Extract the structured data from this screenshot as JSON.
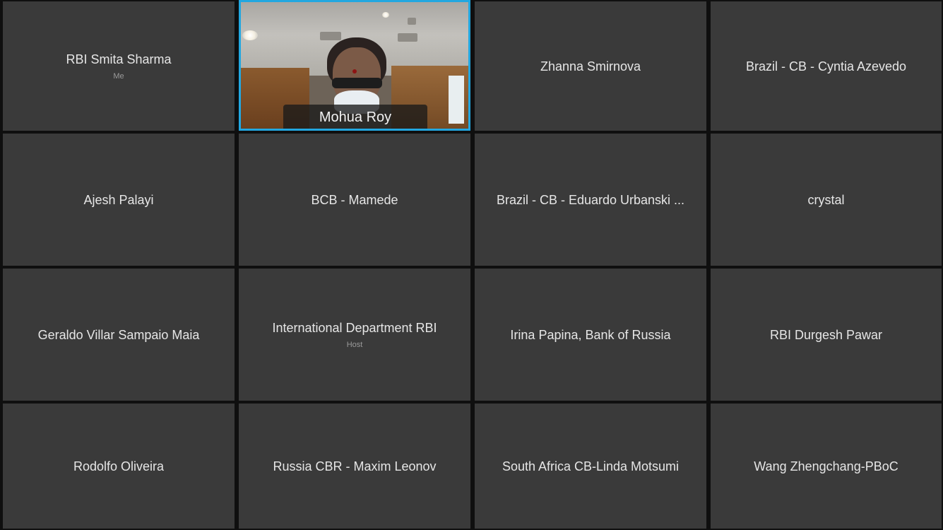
{
  "participants": [
    {
      "name": "RBI Smita Sharma",
      "tag": "Me"
    },
    {
      "name": "Mohua Roy",
      "tag": "",
      "video": true
    },
    {
      "name": "Zhanna Smirnova",
      "tag": ""
    },
    {
      "name": "Brazil - CB - Cyntia Azevedo",
      "tag": ""
    },
    {
      "name": "Ajesh Palayi",
      "tag": ""
    },
    {
      "name": "BCB - Mamede",
      "tag": ""
    },
    {
      "name": "Brazil - CB - Eduardo Urbanski ...",
      "tag": ""
    },
    {
      "name": "crystal",
      "tag": ""
    },
    {
      "name": "Geraldo Villar Sampaio Maia",
      "tag": ""
    },
    {
      "name": "International Department RBI",
      "tag": "Host"
    },
    {
      "name": "Irina Papina, Bank of Russia",
      "tag": ""
    },
    {
      "name": "RBI Durgesh Pawar",
      "tag": ""
    },
    {
      "name": "Rodolfo Oliveira",
      "tag": ""
    },
    {
      "name": "Russia CBR - Maxim Leonov",
      "tag": ""
    },
    {
      "name": "South Africa CB-Linda Motsumi",
      "tag": ""
    },
    {
      "name": "Wang Zhengchang-PBoC",
      "tag": ""
    }
  ],
  "colors": {
    "tile_background": "#3a3a3a",
    "active_speaker_border": "#22a7e0",
    "name_text": "#e6e6e6",
    "sub_text": "#9a9a9a"
  }
}
